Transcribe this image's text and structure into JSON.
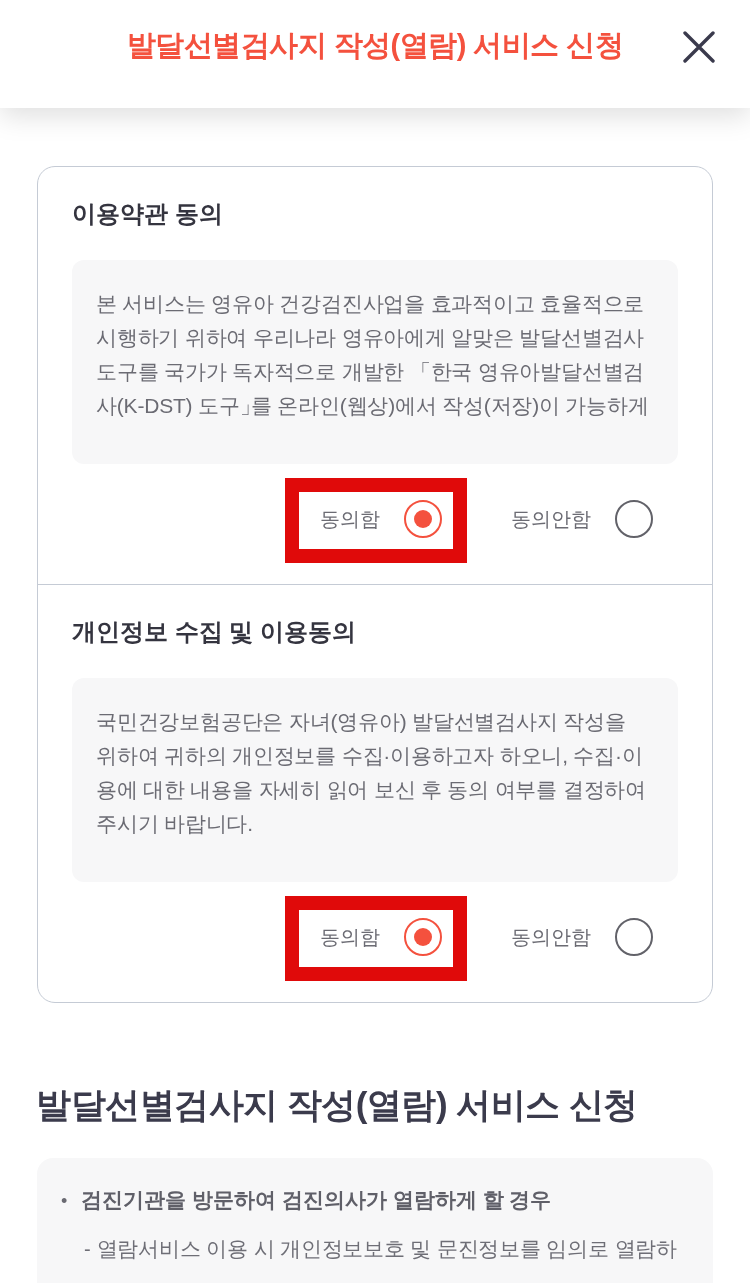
{
  "header": {
    "title": "발달선별검사지 작성(열람) 서비스 신청"
  },
  "consents": [
    {
      "title": "이용약관 동의",
      "body": "본 서비스는 영유아 건강검진사업을 효과적이고 효율적으로 시행하기 위하여 우리나라 영유아에게 알맞은 발달선별검사 도구를 국가가 독자적으로 개발한 「한국 영유아발달선별검사(K-DST) 도구」를 온라인(웹상)에서 작성(저장)이 가능하게",
      "options": [
        {
          "label": "동의함",
          "selected": true,
          "highlighted": true
        },
        {
          "label": "동의안함",
          "selected": false,
          "highlighted": false
        }
      ]
    },
    {
      "title": "개인정보 수집 및 이용동의",
      "body": "국민건강보험공단은 자녀(영유아) 발달선별검사지 작성을 위하여 귀하의 개인정보를 수집·이용하고자 하오니, 수집·이용에 대한 내용을 자세히 읽어 보신 후 동의 여부를 결정하여 주시기 바랍니다.",
      "options": [
        {
          "label": "동의함",
          "selected": true,
          "highlighted": true
        },
        {
          "label": "동의안함",
          "selected": false,
          "highlighted": false
        }
      ]
    }
  ],
  "application": {
    "heading": "발달선별검사지 작성(열람) 서비스 신청",
    "items": [
      {
        "marker": "•",
        "text": "검진기관을 방문하여 검진의사가 열람하게 할 경우",
        "children": [
          {
            "marker": "-",
            "text": "열람서비스 이용 시 개인정보보호 및 문진정보를 임의로 열람하"
          }
        ]
      }
    ]
  }
}
